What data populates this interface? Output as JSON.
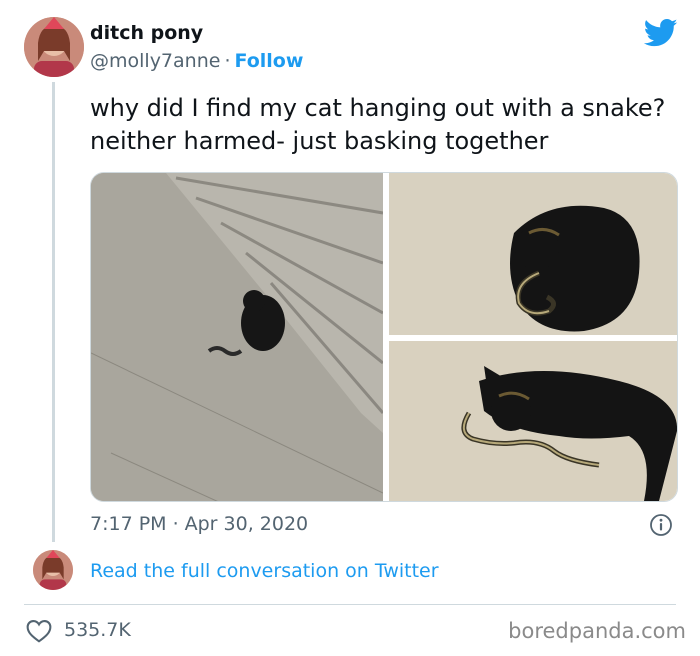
{
  "tweet": {
    "display_name": "ditch pony",
    "handle": "@molly7anne",
    "separator": "·",
    "follow_label": "Follow",
    "text": "why did I find my cat hanging out with a snake? neither harmed- just basking together",
    "time": "7:17 PM",
    "date": "Apr 30, 2020",
    "read_conversation_label": "Read the full conversation on Twitter",
    "like_count": "535.7K"
  },
  "icons": {
    "brand": "twitter-bird-icon",
    "info": "info-icon",
    "like": "heart-icon"
  },
  "colors": {
    "accent": "#1d9bf0",
    "text": "#0f1419",
    "secondary_text": "#536471",
    "border": "#cfd9de"
  },
  "watermark": "boredpanda.com"
}
